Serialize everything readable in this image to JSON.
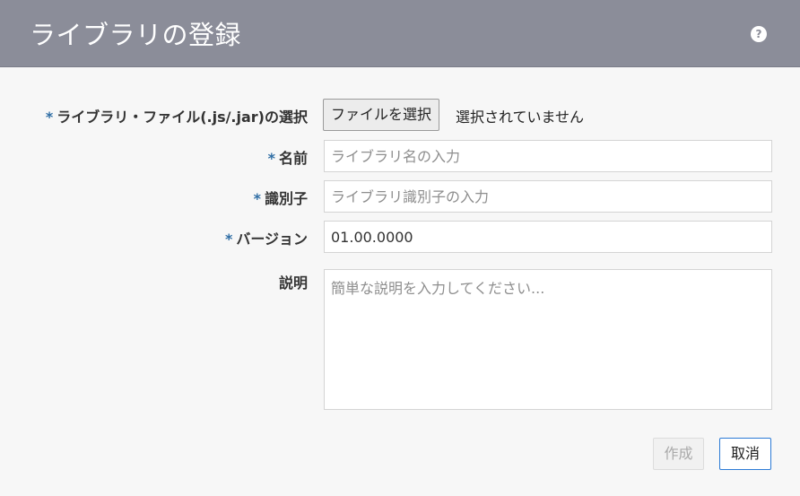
{
  "dialog": {
    "title": "ライブラリの登録",
    "help_icon": "question-circle-icon"
  },
  "form": {
    "file": {
      "required_mark": "*",
      "label": "ライブラリ・ファイル(.js/.jar)の選択",
      "button_label": "ファイルを選択",
      "status": "選択されていません"
    },
    "name": {
      "required_mark": "*",
      "label": "名前",
      "value": "",
      "placeholder": "ライブラリ名の入力"
    },
    "identifier": {
      "required_mark": "*",
      "label": "識別子",
      "value": "",
      "placeholder": "ライブラリ識別子の入力"
    },
    "version": {
      "required_mark": "*",
      "label": "バージョン",
      "value": "01.00.0000",
      "placeholder": ""
    },
    "description": {
      "label": "説明",
      "value": "",
      "placeholder": "簡単な説明を入力してください..."
    }
  },
  "footer": {
    "create_label": "作成",
    "cancel_label": "取消"
  },
  "colors": {
    "header_bg": "#8b8d99",
    "required_mark": "#2e6da4",
    "cancel_border": "#2c7bd6"
  }
}
